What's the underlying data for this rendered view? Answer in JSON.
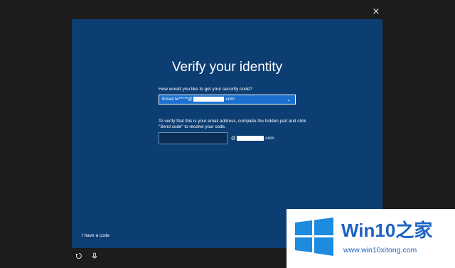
{
  "window": {
    "close_glyph": "×"
  },
  "dialog": {
    "title": "Verify your identity",
    "question": "How would you like to get your security code?",
    "method_select": {
      "prefix": "Email te*****@",
      "suffix": ".com",
      "chevron": "⌄"
    },
    "explain": "To verify that this is your email address, complete the hidden part and click \"Send code\" to receive your code.",
    "email_input": {
      "value": "",
      "placeholder": ""
    },
    "domain_prefix": "@",
    "domain_suffix": ".com",
    "have_code_link": "I have a code"
  },
  "bottom_bar": {
    "icons": [
      "ease-of-access-icon",
      "microphone-icon"
    ]
  },
  "watermark": {
    "brand": "Win10",
    "brand_cn": "之家",
    "url": "www.win10xitong.com",
    "colors": {
      "blue": "#1d62c1"
    }
  },
  "colors": {
    "background": "#1c1c1c",
    "dialog": "#0d3e73",
    "select_accent": "#1a6fd1"
  }
}
